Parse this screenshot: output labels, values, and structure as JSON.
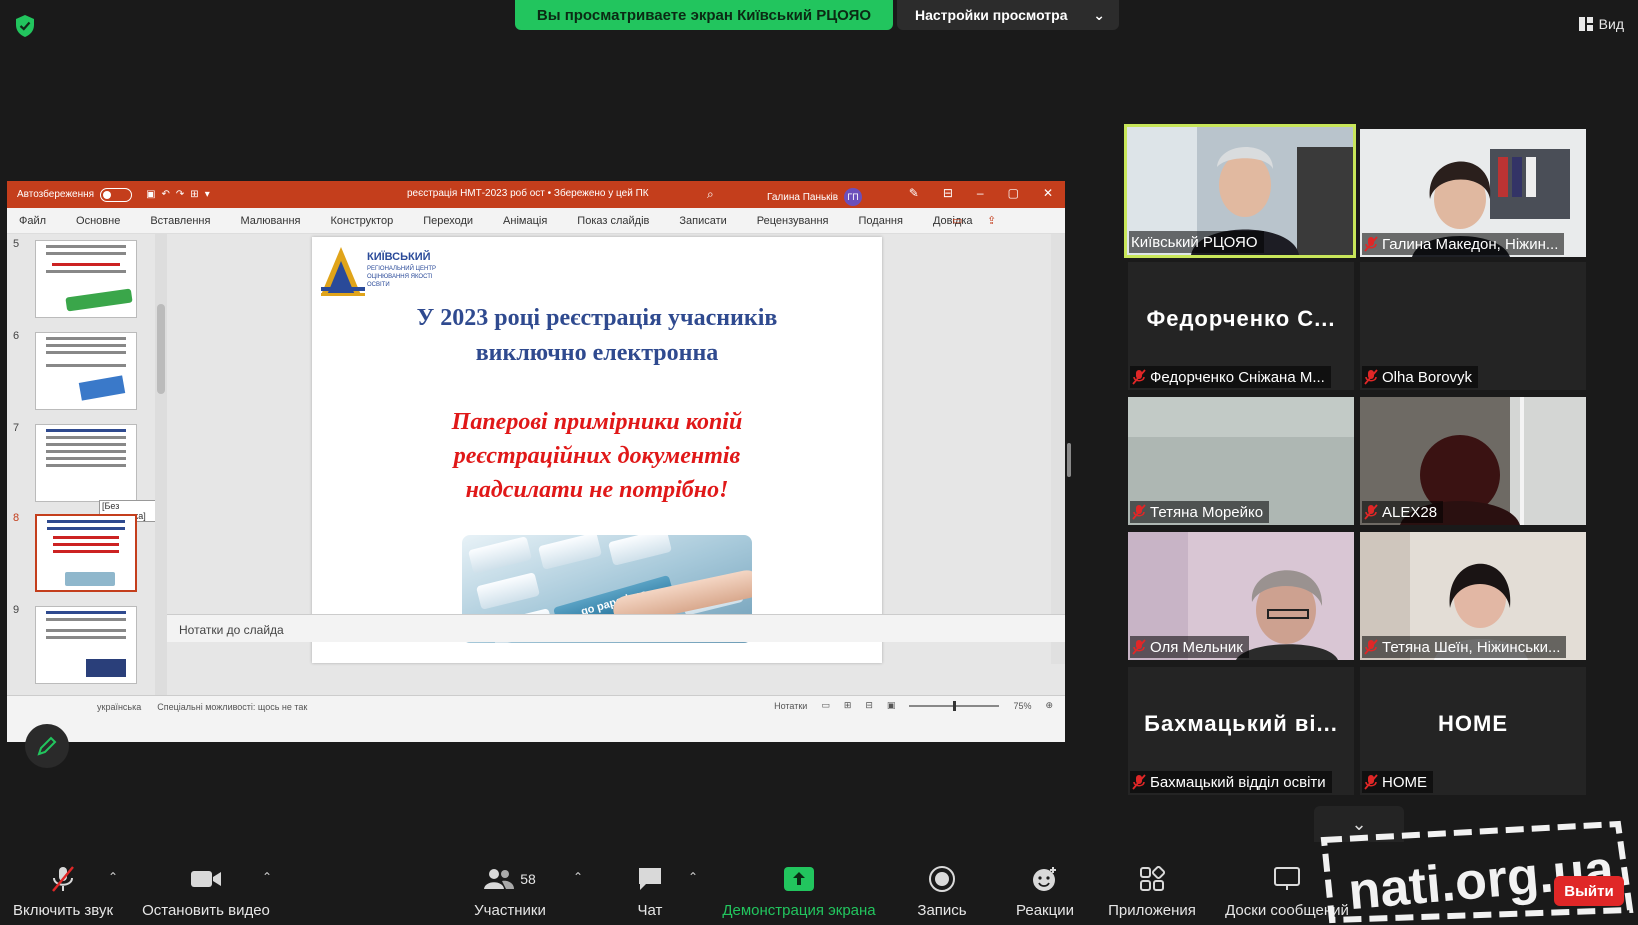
{
  "top": {
    "share_notice": "Вы просматриваете экран Київський РЦОЯО",
    "view_options": "Настройки просмотра",
    "view_label": "Вид"
  },
  "ppt": {
    "autosave": "Автозбереження",
    "document_title": "реєстрація НМТ-2023 роб ост • Збережено у цей ПК",
    "user": "Галина Паньків",
    "user_initials": "ГП",
    "menu": [
      "Файл",
      "Основне",
      "Вставлення",
      "Малювання",
      "Конструктор",
      "Переходи",
      "Анімація",
      "Показ слайдів",
      "Записати",
      "Рецензування",
      "Подання",
      "Довідка"
    ],
    "slide_numbers": [
      "5",
      "6",
      "7",
      "8",
      "9"
    ],
    "tooltip": "[Без заголовка]",
    "notes": "Нотатки до слайда",
    "status_lang": "українська",
    "status_access": "Спеціальні можливості: щось не так",
    "status_notes": "Нотатки",
    "zoom": "75%",
    "slide": {
      "logo_title": "КИЇВСЬКИЙ",
      "logo_sub": "РЕГІОНАЛЬНИЙ ЦЕНТР ОЦІНЮВАННЯ ЯКОСТІ ОСВІТИ",
      "heading_line1": "У 2023 році реєстрація учасників",
      "heading_line2": "виключно електронна",
      "red_line1": "Паперові примірники копій",
      "red_line2": "реєстраційних документів",
      "red_line3": "надсилати не потрібно!",
      "key_label": "go paperless"
    }
  },
  "participants": [
    {
      "name": "Київський РЦОЯО",
      "big": "",
      "muted": false,
      "video": true,
      "speaking": true
    },
    {
      "name": "Галина Македон, Ніжин...",
      "big": "",
      "muted": true,
      "video": true,
      "speaking": false
    },
    {
      "name": "Федорченко Сніжана М...",
      "big": "Федорченко С...",
      "muted": true,
      "video": false,
      "speaking": false
    },
    {
      "name": "Olha Borovyk",
      "big": "",
      "muted": true,
      "video": false,
      "speaking": false
    },
    {
      "name": "Тетяна Морейко",
      "big": "",
      "muted": true,
      "video": true,
      "speaking": false
    },
    {
      "name": "ALEX28",
      "big": "",
      "muted": true,
      "video": true,
      "speaking": false
    },
    {
      "name": "Оля Мельник",
      "big": "",
      "muted": true,
      "video": true,
      "speaking": false
    },
    {
      "name": "Тетяна Шеїн, Ніжинськи...",
      "big": "",
      "muted": true,
      "video": true,
      "speaking": false
    },
    {
      "name": "Бахмацький відділ освіти",
      "big": "Бахмацький ві...",
      "muted": true,
      "video": false,
      "speaking": false
    },
    {
      "name": "HOME",
      "big": "HOME",
      "muted": true,
      "video": false,
      "speaking": false
    }
  ],
  "toolbar": {
    "unmute": "Включить звук",
    "stop_video": "Остановить видео",
    "participants": "Участники",
    "participants_count": "58",
    "chat": "Чат",
    "share": "Демонстрация экрана",
    "record": "Запись",
    "reactions": "Реакции",
    "apps": "Приложения",
    "whiteboards": "Доски сообщений",
    "leave": "Выйти"
  },
  "watermark": "nati.org.ua",
  "colors": {
    "accent_green": "#22c55e",
    "ppt_red": "#c43e1c",
    "leave_red": "#e02727",
    "speaking_border": "#c8e65a"
  }
}
